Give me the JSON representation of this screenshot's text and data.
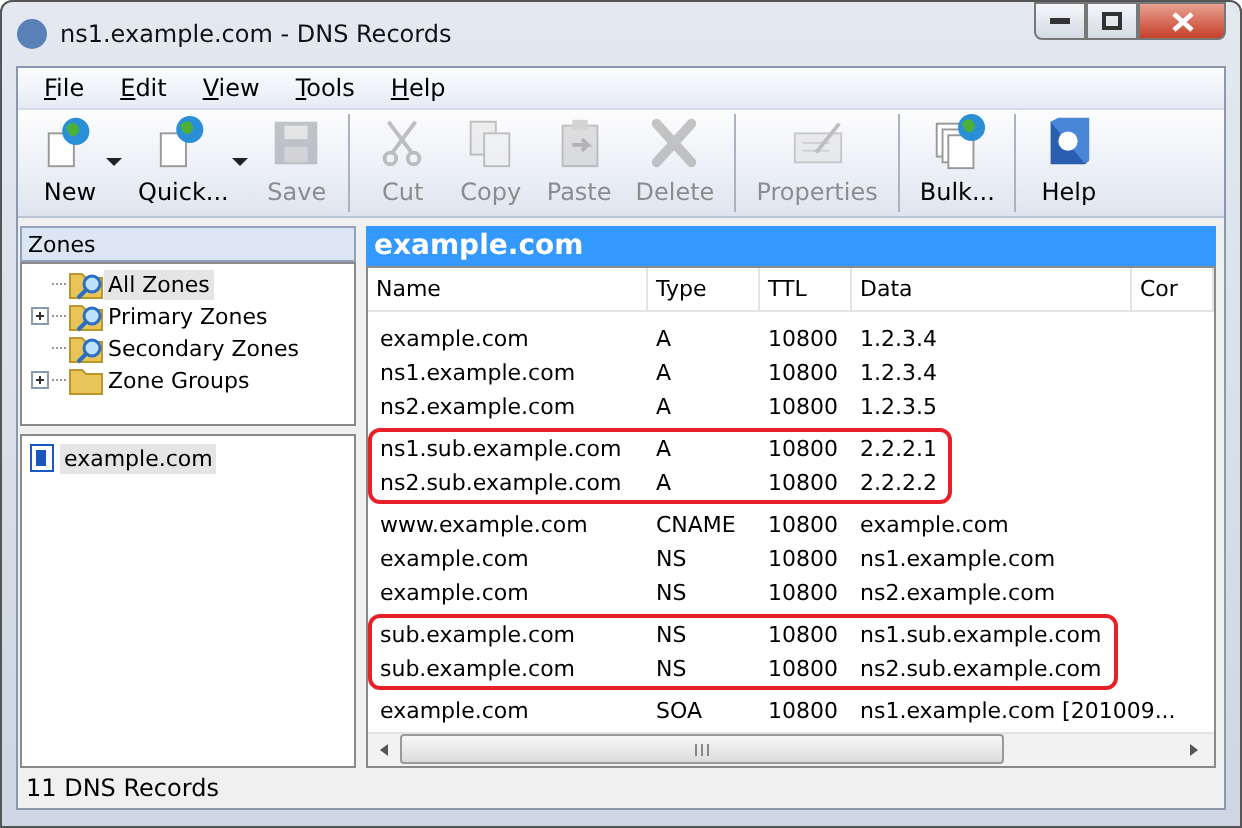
{
  "window": {
    "title": "ns1.example.com - DNS Records"
  },
  "menu": [
    "File",
    "Edit",
    "View",
    "Tools",
    "Help"
  ],
  "toolbar": [
    [
      {
        "label": "New",
        "disabled": false,
        "dropdown": true
      },
      {
        "label": "Quick...",
        "disabled": false,
        "dropdown": true
      },
      {
        "label": "Save",
        "disabled": true,
        "dropdown": false
      }
    ],
    [
      {
        "label": "Cut",
        "disabled": true,
        "dropdown": false
      },
      {
        "label": "Copy",
        "disabled": true,
        "dropdown": false
      },
      {
        "label": "Paste",
        "disabled": true,
        "dropdown": false
      },
      {
        "label": "Delete",
        "disabled": true,
        "dropdown": false
      }
    ],
    [
      {
        "label": "Properties",
        "disabled": true,
        "dropdown": false
      }
    ],
    [
      {
        "label": "Bulk...",
        "disabled": false,
        "dropdown": false
      }
    ],
    [
      {
        "label": "Help",
        "disabled": false,
        "dropdown": false
      }
    ]
  ],
  "zones": {
    "title": "Zones",
    "tree": [
      {
        "label": "All Zones",
        "selected": true,
        "expandable": false
      },
      {
        "label": "Primary Zones",
        "selected": false,
        "expandable": true
      },
      {
        "label": "Secondary Zones",
        "selected": false,
        "expandable": false
      },
      {
        "label": "Zone Groups",
        "selected": false,
        "expandable": true
      }
    ],
    "list": [
      {
        "label": "example.com",
        "selected": true
      }
    ]
  },
  "records": {
    "title": "example.com",
    "columns": [
      "Name",
      "Type",
      "TTL",
      "Data",
      "Cor"
    ],
    "groups": [
      {
        "highlighted": false,
        "rows": [
          [
            "example.com",
            "A",
            "10800",
            "1.2.3.4"
          ],
          [
            "ns1.example.com",
            "A",
            "10800",
            "1.2.3.4"
          ],
          [
            "ns2.example.com",
            "A",
            "10800",
            "1.2.3.5"
          ]
        ]
      },
      {
        "highlighted": true,
        "rows": [
          [
            "ns1.sub.example.com",
            "A",
            "10800",
            "2.2.2.1"
          ],
          [
            "ns2.sub.example.com",
            "A",
            "10800",
            "2.2.2.2"
          ]
        ]
      },
      {
        "highlighted": false,
        "rows": [
          [
            "www.example.com",
            "CNAME",
            "10800",
            "example.com"
          ],
          [
            "example.com",
            "NS",
            "10800",
            "ns1.example.com"
          ],
          [
            "example.com",
            "NS",
            "10800",
            "ns2.example.com"
          ]
        ]
      },
      {
        "highlighted": true,
        "rows": [
          [
            "sub.example.com",
            "NS",
            "10800",
            "ns1.sub.example.com"
          ],
          [
            "sub.example.com",
            "NS",
            "10800",
            "ns2.sub.example.com"
          ]
        ]
      },
      {
        "highlighted": false,
        "rows": [
          [
            "example.com",
            "SOA",
            "10800",
            "ns1.example.com [201009..."
          ]
        ]
      }
    ]
  },
  "status_bar": "11 DNS Records"
}
